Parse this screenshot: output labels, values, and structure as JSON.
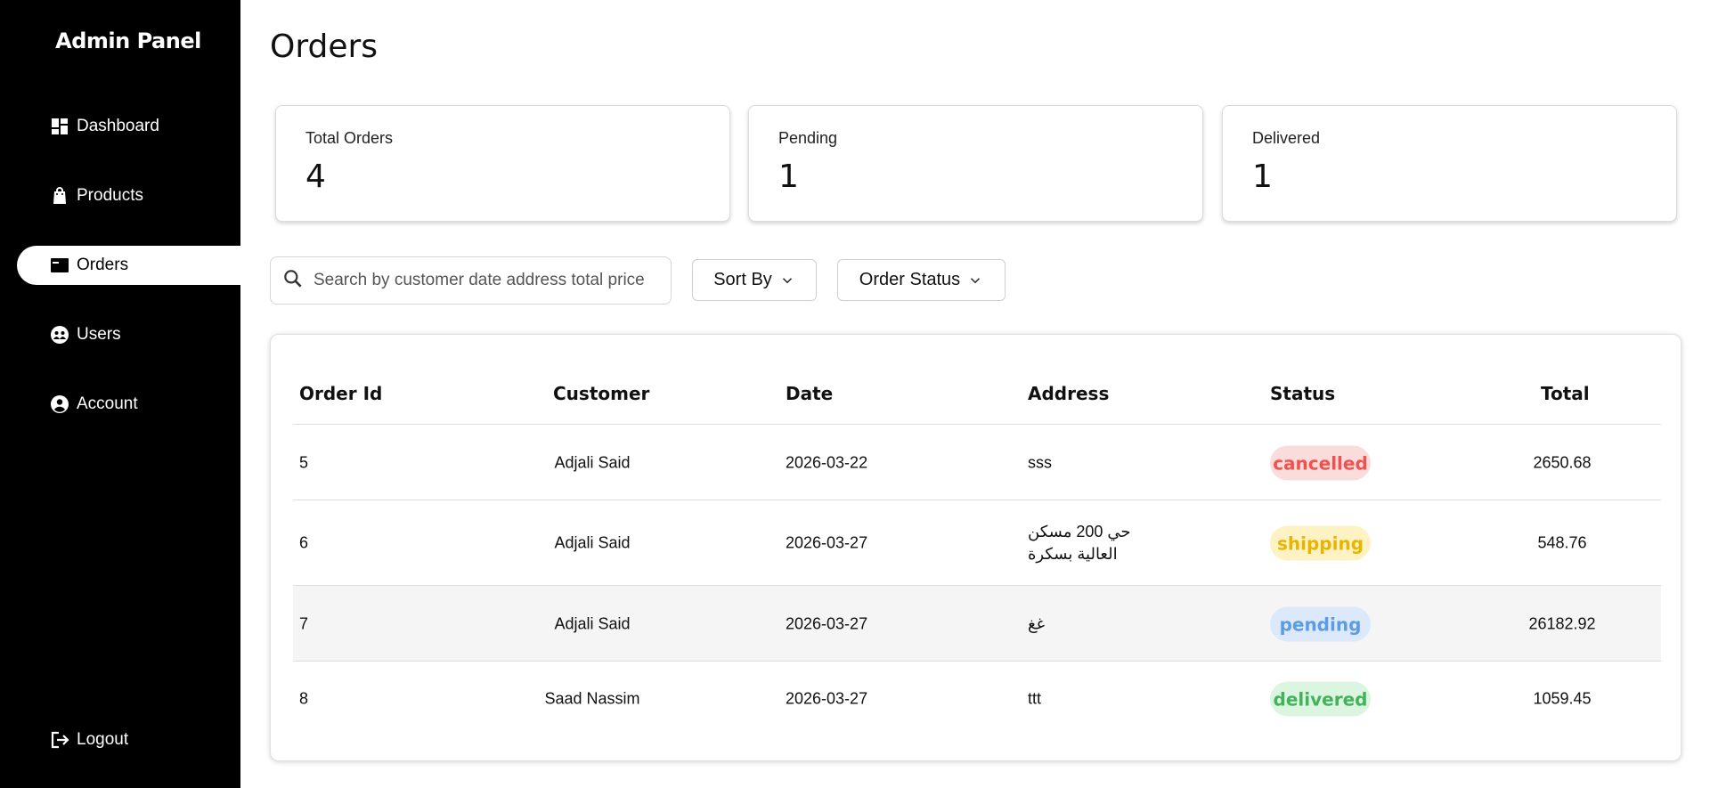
{
  "sidebar": {
    "brand": "Admin Panel",
    "items": [
      {
        "label": "Dashboard",
        "icon": "dashboard-icon"
      },
      {
        "label": "Products",
        "icon": "shopping-bag-icon"
      },
      {
        "label": "Orders",
        "icon": "orders-icon",
        "active": true
      },
      {
        "label": "Users",
        "icon": "users-icon"
      },
      {
        "label": "Account",
        "icon": "account-circle-icon"
      }
    ],
    "logout": {
      "label": "Logout",
      "icon": "logout-icon"
    }
  },
  "page": {
    "title": "Orders"
  },
  "stats": [
    {
      "label": "Total Orders",
      "value": "4"
    },
    {
      "label": "Pending",
      "value": "1"
    },
    {
      "label": "Delivered",
      "value": "1"
    }
  ],
  "filters": {
    "search_placeholder": "Search by customer date address total price",
    "sort_label": "Sort By",
    "status_label": "Order Status"
  },
  "table": {
    "headers": [
      "Order Id",
      "Customer",
      "Date",
      "Address",
      "Status",
      "Total"
    ],
    "rows": [
      {
        "id": "5",
        "customer": "Adjali Said",
        "date": "2026-03-22",
        "address_1": "sss",
        "address_2": "",
        "status": "cancelled",
        "total": "2650.68"
      },
      {
        "id": "6",
        "customer": "Adjali Said",
        "date": "2026-03-27",
        "address_1": "حي 200 مسكن",
        "address_2": "العالية بسكرة",
        "status": "shipping",
        "total": "548.76"
      },
      {
        "id": "7",
        "customer": "Adjali Said",
        "date": "2026-03-27",
        "address_1": "غغ",
        "address_2": "",
        "status": "pending",
        "total": "26182.92"
      },
      {
        "id": "8",
        "customer": "Saad Nassim",
        "date": "2026-03-27",
        "address_1": "ttt",
        "address_2": "",
        "status": "delivered",
        "total": "1059.45"
      }
    ]
  },
  "status_colors": {
    "cancelled": {
      "bg": "#fbdcdc",
      "fg": "#ef5350"
    },
    "shipping": {
      "bg": "#fdf2c4",
      "fg": "#e9b400"
    },
    "pending": {
      "bg": "#dbe9fb",
      "fg": "#5c9ce6"
    },
    "delivered": {
      "bg": "#dcf5e1",
      "fg": "#43b35a"
    }
  }
}
